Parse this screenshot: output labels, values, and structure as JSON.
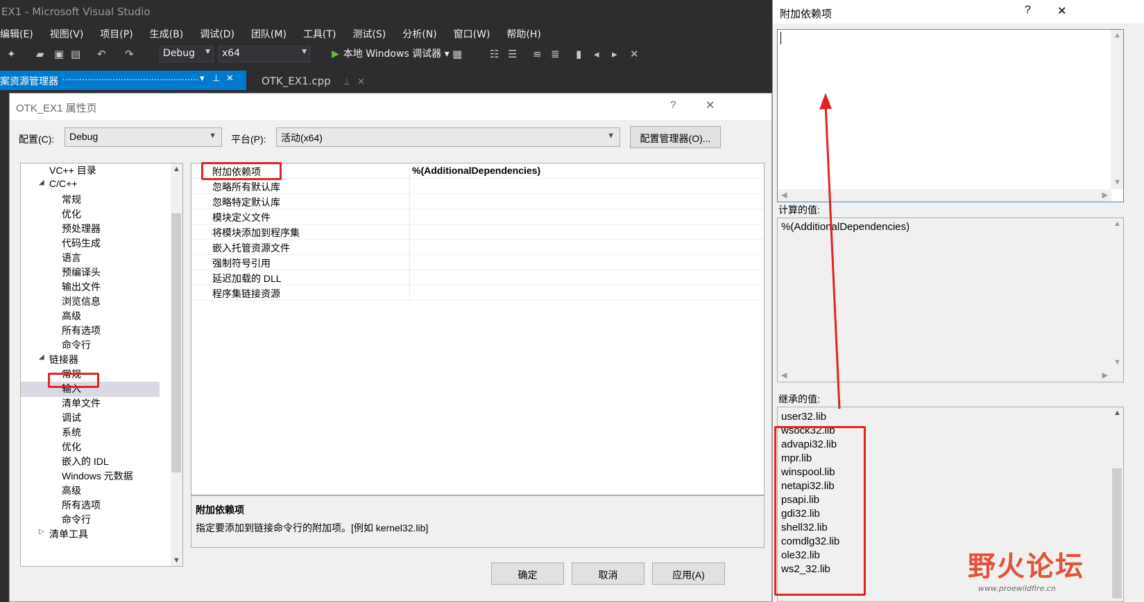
{
  "vs": {
    "title": "EX1 - Microsoft Visual Studio",
    "menu": [
      "编辑(E)",
      "视图(V)",
      "项目(P)",
      "生成(B)",
      "调试(D)",
      "团队(M)",
      "工具(T)",
      "测试(S)",
      "分析(N)",
      "窗口(W)",
      "帮助(H)"
    ],
    "config": "Debug",
    "platform": "x64",
    "run_label": "本地 Windows 调试器",
    "solution_explorer": "案资源管理器",
    "tab": "OTK_EX1.cpp"
  },
  "dialog": {
    "title": "OTK_EX1 属性页",
    "help": "?",
    "close": "✕",
    "config_label": "配置(C):",
    "config_value": "Debug",
    "platform_label": "平台(P):",
    "platform_value": "活动(x64)",
    "config_manager": "配置管理器(O)...",
    "tree": [
      {
        "label": "VC++ 目录",
        "level": 1
      },
      {
        "label": "C/C++",
        "level": 1,
        "expanded": true
      },
      {
        "label": "常规",
        "level": 2
      },
      {
        "label": "优化",
        "level": 2
      },
      {
        "label": "预处理器",
        "level": 2
      },
      {
        "label": "代码生成",
        "level": 2
      },
      {
        "label": "语言",
        "level": 2
      },
      {
        "label": "预编译头",
        "level": 2
      },
      {
        "label": "输出文件",
        "level": 2
      },
      {
        "label": "浏览信息",
        "level": 2
      },
      {
        "label": "高级",
        "level": 2
      },
      {
        "label": "所有选项",
        "level": 2
      },
      {
        "label": "命令行",
        "level": 2
      },
      {
        "label": "链接器",
        "level": 1,
        "expanded": true
      },
      {
        "label": "常规",
        "level": 2
      },
      {
        "label": "输入",
        "level": 2,
        "selected": true
      },
      {
        "label": "清单文件",
        "level": 2
      },
      {
        "label": "调试",
        "level": 2
      },
      {
        "label": "系统",
        "level": 2
      },
      {
        "label": "优化",
        "level": 2
      },
      {
        "label": "嵌入的 IDL",
        "level": 2
      },
      {
        "label": "Windows 元数据",
        "level": 2
      },
      {
        "label": "高级",
        "level": 2
      },
      {
        "label": "所有选项",
        "level": 2
      },
      {
        "label": "命令行",
        "level": 2
      },
      {
        "label": "清单工具",
        "level": 1,
        "expanded": false
      }
    ],
    "props": [
      {
        "name": "附加依赖项",
        "value": "%(AdditionalDependencies)"
      },
      {
        "name": "忽略所有默认库",
        "value": ""
      },
      {
        "name": "忽略特定默认库",
        "value": ""
      },
      {
        "name": "模块定义文件",
        "value": ""
      },
      {
        "name": "将模块添加到程序集",
        "value": ""
      },
      {
        "name": "嵌入托管资源文件",
        "value": ""
      },
      {
        "name": "强制符号引用",
        "value": ""
      },
      {
        "name": "延迟加载的 DLL",
        "value": ""
      },
      {
        "name": "程序集链接资源",
        "value": ""
      }
    ],
    "desc_title": "附加依赖项",
    "desc_text": "指定要添加到链接命令行的附加项。[例如 kernel32.lib]",
    "ok": "确定",
    "cancel": "取消",
    "apply": "应用(A)"
  },
  "popup": {
    "title": "附加依赖项",
    "help": "?",
    "close": "✕",
    "edit_value": "",
    "computed_label": "计算的值:",
    "computed_value": "%(AdditionalDependencies)",
    "inherited_label": "继承的值:",
    "inherited": [
      "user32.lib",
      "wsock32.lib",
      "advapi32.lib",
      "mpr.lib",
      "winspool.lib",
      "netapi32.lib",
      "psapi.lib",
      "gdi32.lib",
      "shell32.lib",
      "comdlg32.lib",
      "ole32.lib",
      "ws2_32.lib"
    ]
  },
  "watermark": {
    "text": "野火论坛",
    "url": "www.proewildfire.cn"
  },
  "colors": {
    "accent": "#007acc",
    "highlight": "#e32222",
    "selection": "#cce8ff"
  }
}
